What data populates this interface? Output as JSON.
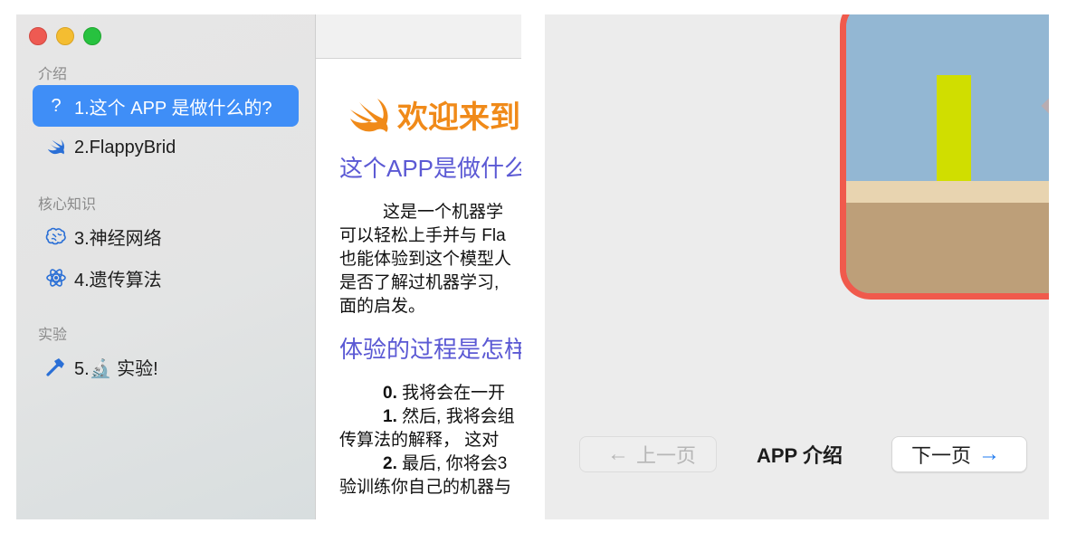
{
  "sidebar": {
    "sections": [
      {
        "header": "介绍",
        "items": [
          {
            "icon": "question-icon",
            "label": "1.这个 APP 是做什么的?",
            "selected": true
          },
          {
            "icon": "swift-bird-icon",
            "label": "2.FlappyBrid"
          }
        ]
      },
      {
        "header": "核心知识",
        "items": [
          {
            "icon": "brain-icon",
            "label": "3.神经网络"
          },
          {
            "icon": "atom-icon",
            "label": "4.遗传算法"
          }
        ]
      },
      {
        "header": "实验",
        "items": [
          {
            "icon": "hammer-icon",
            "label": "5.🔬 实验!"
          }
        ]
      }
    ]
  },
  "doc": {
    "welcome": "欢迎来到",
    "h1": "这个APP是做什么",
    "para1": [
      "这是一个机器学",
      "可以轻松上手并与 Fla",
      "也能体验到这个模型人",
      "是否了解过机器学习,",
      "面的启发。"
    ],
    "h2": "体验的过程是怎样",
    "steps": [
      {
        "num": "0.",
        "text": " 我将会在一开"
      },
      {
        "num": "1.",
        "text": " 然后, 我将会组"
      },
      {
        "num": "",
        "text": "传算法的解释， 这对"
      },
      {
        "num": "2.",
        "text": " 最后, 你将会3"
      },
      {
        "num": "",
        "text": "验训练你自己的机器与"
      }
    ]
  },
  "pager": {
    "prev_label": "上一页",
    "page_title": "APP 介绍",
    "next_label": "下一页"
  },
  "colors": {
    "accent_blue": "#3f8ef7",
    "swift_orange": "#f08a19",
    "heading_purple": "#5b59d4",
    "frame_red": "#f05a4c",
    "pipe_yellow": "#d0de00"
  }
}
